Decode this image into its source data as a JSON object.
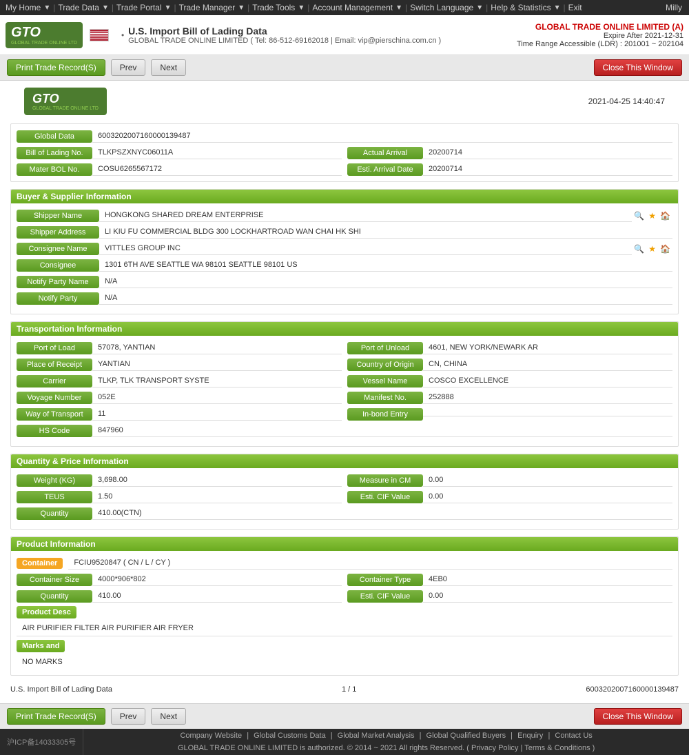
{
  "nav": {
    "items": [
      "My Home",
      "Trade Data",
      "Trade Portal",
      "Trade Manager",
      "Trade Tools",
      "Account Management",
      "Switch Language",
      "Help & Statistics",
      "Exit"
    ],
    "user": "Milly"
  },
  "header": {
    "logo_main": "GTO",
    "logo_sub": "GLOBAL TRADE ONLINE LTD",
    "datasource": "U.S. Import Bill of Lading Data",
    "company_contact": "GLOBAL TRADE ONLINE LIMITED ( Tel: 86-512-69162018 | Email: vip@pierschina.com.cn )",
    "company_right": "GLOBAL TRADE ONLINE LIMITED (A)",
    "expire": "Expire After 2021-12-31",
    "time_range": "Time Range Accessible (LDR) : 201001 ~ 202104"
  },
  "toolbar": {
    "print_label": "Print Trade Record(S)",
    "prev_label": "Prev",
    "next_label": "Next",
    "close_label": "Close This Window"
  },
  "content": {
    "timestamp": "2021-04-25  14:40:47",
    "global_data_label": "Global Data",
    "global_data_value": "6003202007160000139487",
    "bill_of_lading_label": "Bill of Lading No.",
    "bill_of_lading_value": "TLKPSZXNYC06011A",
    "actual_arrival_label": "Actual Arrival",
    "actual_arrival_value": "20200714",
    "mater_bol_label": "Mater BOL No.",
    "mater_bol_value": "COSU6265567172",
    "esti_arrival_label": "Esti. Arrival Date",
    "esti_arrival_value": "20200714",
    "buyer_supplier": {
      "title": "Buyer & Supplier Information",
      "shipper_name_label": "Shipper Name",
      "shipper_name_value": "HONGKONG SHARED DREAM ENTERPRISE",
      "shipper_address_label": "Shipper Address",
      "shipper_address_value": "LI KIU FU COMMERCIAL BLDG 300 LOCKHARTROAD WAN CHAI HK SHI",
      "consignee_name_label": "Consignee Name",
      "consignee_name_value": "VITTLES GROUP INC",
      "consignee_label": "Consignee",
      "consignee_value": "1301 6TH AVE SEATTLE WA 98101 SEATTLE 98101 US",
      "notify_party_name_label": "Notify Party Name",
      "notify_party_name_value": "N/A",
      "notify_party_label": "Notify Party",
      "notify_party_value": "N/A"
    },
    "transportation": {
      "title": "Transportation Information",
      "port_of_load_label": "Port of Load",
      "port_of_load_value": "57078, YANTIAN",
      "port_of_unload_label": "Port of Unload",
      "port_of_unload_value": "4601, NEW YORK/NEWARK AR",
      "place_of_receipt_label": "Place of Receipt",
      "place_of_receipt_value": "YANTIAN",
      "country_of_origin_label": "Country of Origin",
      "country_of_origin_value": "CN, CHINA",
      "carrier_label": "Carrier",
      "carrier_value": "TLKP, TLK TRANSPORT SYSTE",
      "vessel_name_label": "Vessel Name",
      "vessel_name_value": "COSCO EXCELLENCE",
      "voyage_number_label": "Voyage Number",
      "voyage_number_value": "052E",
      "manifest_no_label": "Manifest No.",
      "manifest_no_value": "252888",
      "way_of_transport_label": "Way of Transport",
      "way_of_transport_value": "11",
      "in_bond_entry_label": "In-bond Entry",
      "in_bond_entry_value": "",
      "hs_code_label": "HS Code",
      "hs_code_value": "847960"
    },
    "quantity_price": {
      "title": "Quantity & Price Information",
      "weight_label": "Weight (KG)",
      "weight_value": "3,698.00",
      "measure_label": "Measure in CM",
      "measure_value": "0.00",
      "teus_label": "TEUS",
      "teus_value": "1.50",
      "esti_cif_label": "Esti. CIF Value",
      "esti_cif_value": "0.00",
      "quantity_label": "Quantity",
      "quantity_value": "410.00(CTN)"
    },
    "product": {
      "title": "Product Information",
      "container_badge": "Container",
      "container_value": "FCIU9520847 ( CN / L / CY )",
      "container_size_label": "Container Size",
      "container_size_value": "4000*906*802",
      "container_type_label": "Container Type",
      "container_type_value": "4EB0",
      "quantity_label": "Quantity",
      "quantity_value": "410.00",
      "esti_cif_label": "Esti. CIF Value",
      "esti_cif_value": "0.00",
      "product_desc_label": "Product Desc",
      "product_desc_value": "AIR PURIFIER FILTER AIR PURIFIER AIR FRYER",
      "marks_label": "Marks and",
      "marks_value": "NO MARKS"
    },
    "bottom_bar": {
      "datasource": "U.S. Import Bill of Lading Data",
      "page_info": "1 / 1",
      "record_id": "6003202007160000139487"
    }
  },
  "footer": {
    "links": [
      "Company Website",
      "Global Customs Data",
      "Global Market Analysis",
      "Global Qualified Buyers",
      "Enquiry",
      "Contact Us"
    ],
    "copyright": "GLOBAL TRADE ONLINE LIMITED is authorized. © 2014 ~ 2021 All rights Reserved.",
    "privacy_label": "Privacy Policy",
    "terms_label": "Terms & Conditions",
    "icp": "沪ICP备14033305号"
  }
}
